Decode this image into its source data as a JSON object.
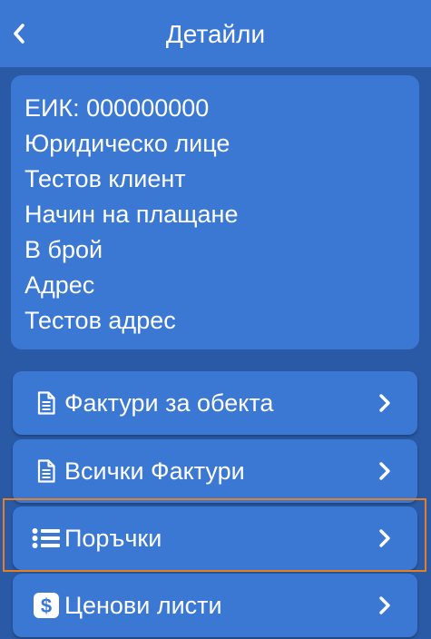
{
  "header": {
    "title": "Детайли",
    "back_icon": "chevron-left-icon"
  },
  "info": {
    "lines": [
      "ЕИК: 000000000",
      "Юридическо лице",
      "Тестов клиент",
      "Начин на плащане",
      "В брой",
      "Адрес",
      "Тестов адрес"
    ]
  },
  "menu": {
    "items": [
      {
        "label": "Фактури за обекта",
        "icon": "document-icon"
      },
      {
        "label": "Всички Фактури",
        "icon": "document-icon"
      },
      {
        "label": "Поръчки",
        "icon": "list-icon"
      },
      {
        "label": "Ценови листи",
        "icon": "dollar-icon"
      }
    ]
  },
  "colors": {
    "background": "#2a5aa6",
    "surface": "#3a78d4",
    "text": "#ffffff",
    "highlight": "#e67e22"
  }
}
